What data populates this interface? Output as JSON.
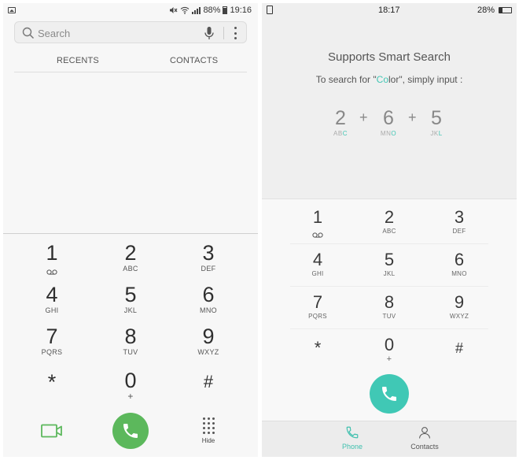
{
  "left": {
    "status": {
      "battery": "88%",
      "time": "19:16"
    },
    "search": {
      "placeholder": "Search"
    },
    "tabs": [
      "RECENTS",
      "CONTACTS"
    ],
    "keys": [
      {
        "digit": "1",
        "letters": ""
      },
      {
        "digit": "2",
        "letters": "ABC"
      },
      {
        "digit": "3",
        "letters": "DEF"
      },
      {
        "digit": "4",
        "letters": "GHI"
      },
      {
        "digit": "5",
        "letters": "JKL"
      },
      {
        "digit": "6",
        "letters": "MNO"
      },
      {
        "digit": "7",
        "letters": "PQRS"
      },
      {
        "digit": "8",
        "letters": "TUV"
      },
      {
        "digit": "9",
        "letters": "WXYZ"
      },
      {
        "digit": "*",
        "letters": ""
      },
      {
        "digit": "0",
        "letters": "+"
      },
      {
        "digit": "#",
        "letters": ""
      }
    ],
    "bottom": {
      "hide_label": "Hide"
    },
    "colors": {
      "call": "#5cb85c",
      "video": "#5cb85c"
    },
    "icons": [
      "gallery-icon",
      "mute-icon",
      "wifi-icon",
      "signal-icon",
      "battery-icon",
      "search-icon",
      "mic-icon",
      "more-icon",
      "voicemail-icon",
      "video-call-icon",
      "phone-icon",
      "dialpad-icon"
    ]
  },
  "right": {
    "status": {
      "time": "18:17",
      "battery": "28%"
    },
    "hint": {
      "title": "Supports Smart Search",
      "sub_pre": "To search for \"",
      "sub_hl": "Co",
      "sub_mid": "lo",
      "sub_post": "r\", simply input :"
    },
    "example": [
      {
        "digit": "2",
        "pre": "AB",
        "hl": "C",
        "post": ""
      },
      {
        "digit": "6",
        "pre": "MN",
        "hl": "O",
        "post": ""
      },
      {
        "digit": "5",
        "pre": "JK",
        "hl": "L",
        "post": ""
      }
    ],
    "plus": "+",
    "keys": [
      {
        "digit": "1",
        "letters": ""
      },
      {
        "digit": "2",
        "letters": "ABC"
      },
      {
        "digit": "3",
        "letters": "DEF"
      },
      {
        "digit": "4",
        "letters": "GHI"
      },
      {
        "digit": "5",
        "letters": "JKL"
      },
      {
        "digit": "6",
        "letters": "MNO"
      },
      {
        "digit": "7",
        "letters": "PQRS"
      },
      {
        "digit": "8",
        "letters": "TUV"
      },
      {
        "digit": "9",
        "letters": "WXYZ"
      },
      {
        "digit": "*",
        "letters": ""
      },
      {
        "digit": "0",
        "letters": "+"
      },
      {
        "digit": "#",
        "letters": ""
      }
    ],
    "nav": [
      {
        "label": "Phone",
        "active": true
      },
      {
        "label": "Contacts",
        "active": false
      }
    ],
    "colors": {
      "accent": "#40c8b5"
    },
    "icons": [
      "sim-icon",
      "battery-icon",
      "voicemail-icon",
      "phone-icon",
      "contacts-icon"
    ]
  }
}
